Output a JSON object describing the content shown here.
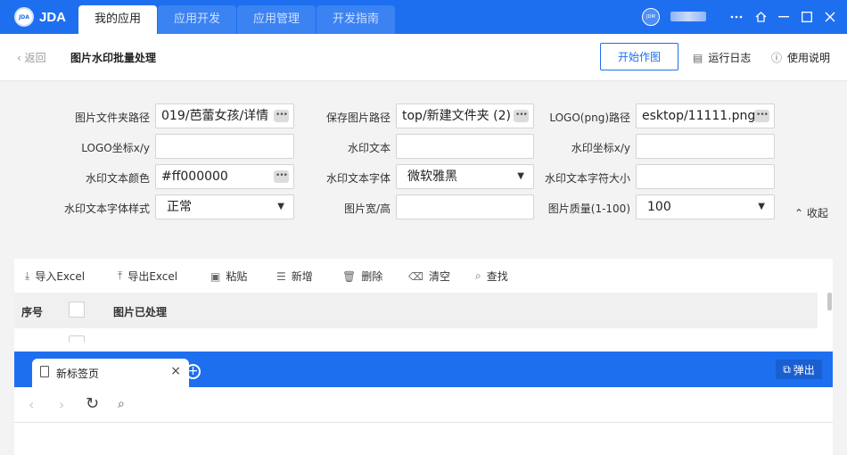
{
  "app": {
    "logo_badge": "JDA",
    "logo_text": "JDA",
    "tabs": [
      "我的应用",
      "应用开发",
      "应用管理",
      "开发指南"
    ],
    "avatar_text": "JDM"
  },
  "header": {
    "back_label": "返回",
    "page_title": "图片水印批量处理",
    "start_button": "开始作图",
    "log_label": "运行日志",
    "help_label": "使用说明"
  },
  "form": {
    "fields": [
      {
        "label": "图片文件夹路径",
        "value": "019/芭蕾女孩/详情"
      },
      {
        "label": "保存图片路径",
        "value": "top/新建文件夹 (2)"
      },
      {
        "label": "LOGO(png)路径",
        "value": "esktop/11111.png"
      },
      {
        "label": "LOGO坐标x/y",
        "value": ""
      },
      {
        "label": "水印文本",
        "value": ""
      },
      {
        "label": "水印坐标x/y",
        "value": ""
      },
      {
        "label": "水印文本颜色",
        "value": "#ff000000"
      },
      {
        "label": "水印文本字体",
        "value": "微软雅黑"
      },
      {
        "label": "水印文本字符大小",
        "value": ""
      },
      {
        "label": "水印文本字体样式",
        "value": "正常"
      },
      {
        "label": "图片宽/高",
        "value": ""
      },
      {
        "label": "图片质量(1-100)",
        "value": "100"
      }
    ],
    "collapse_label": "收起"
  },
  "toolbar": {
    "items": [
      "导入Excel",
      "导出Excel",
      "粘贴",
      "新增",
      "删除",
      "清空",
      "查找"
    ]
  },
  "table": {
    "columns": [
      "序号",
      "图片已处理"
    ]
  },
  "browser": {
    "tab_title": "新标签页",
    "popout_label": "弹出"
  }
}
